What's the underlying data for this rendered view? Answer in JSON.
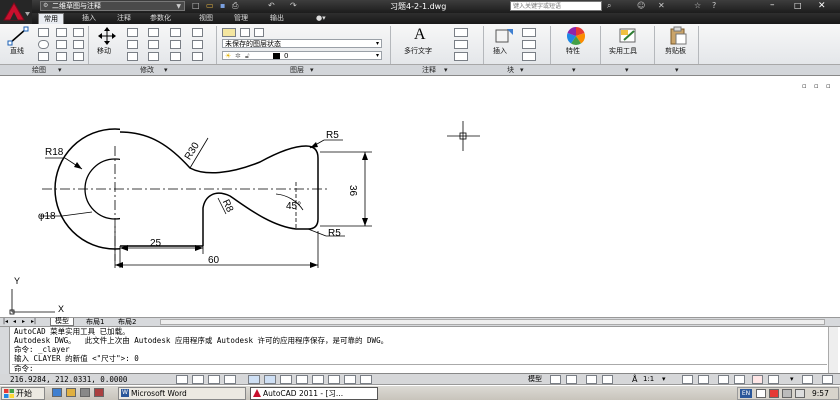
{
  "window": {
    "workspace": "二维草图与注释",
    "title": "习题4-2-1.dwg",
    "search_placeholder": "键入关键字或短语"
  },
  "ribbon_tabs": [
    "常用",
    "插入",
    "注释",
    "参数化",
    "视图",
    "管理",
    "输出"
  ],
  "ribbon": {
    "draw": {
      "line_label": "直线",
      "panel_label": "绘图"
    },
    "modify": {
      "move_label": "移动",
      "panel_label": "修改"
    },
    "layers": {
      "state_value": "未保存的图层状态",
      "layer_value": "0",
      "panel_label": "图层"
    },
    "annotation": {
      "text_label": "多行文字",
      "panel_label": "注释"
    },
    "block": {
      "insert_label": "插入",
      "panel_label": "块"
    },
    "props": {
      "label": "特性"
    },
    "utilities": {
      "label": "实用工具"
    },
    "clipboard": {
      "label": "剪贴板"
    }
  },
  "drawing": {
    "dims": {
      "r18": "R18",
      "r30": "R30",
      "r5_top": "R5",
      "r8": "R8",
      "angle": "45°",
      "h36": "36",
      "phi18": "φ18",
      "r5_bottom": "R5",
      "d25": "25",
      "d60": "60"
    },
    "ucs": {
      "x": "X",
      "y": "Y"
    }
  },
  "layout_tabs": [
    "模型",
    "布局1",
    "布局2"
  ],
  "command_lines": [
    "AutoCAD 菜单实用工具 已加载。",
    "Autodesk DWG。  此文件上次由 Autodesk 应用程序或 Autodesk 许可的应用程序保存，是可靠的 DWG。",
    "命令: _clayer",
    "输入 CLAYER 的新值 <\"尺寸\">: 0"
  ],
  "command_prompt": "命令:",
  "status": {
    "coords": "216.9284, 212.0331, 0.0000",
    "space": "模型",
    "scale": "1:1",
    "arrow_down": "▾"
  },
  "taskbar": {
    "start": "开始",
    "tasks": [
      "Microsoft Word",
      "AutoCAD 2011 - [习..."
    ],
    "lang": "EN",
    "time": "9:57"
  },
  "colors": {
    "ribbon_bg": "#e4e7eb",
    "titlebar": "#2b2b2b",
    "logo_red": "#c8102e",
    "crosshair": "#000000"
  }
}
